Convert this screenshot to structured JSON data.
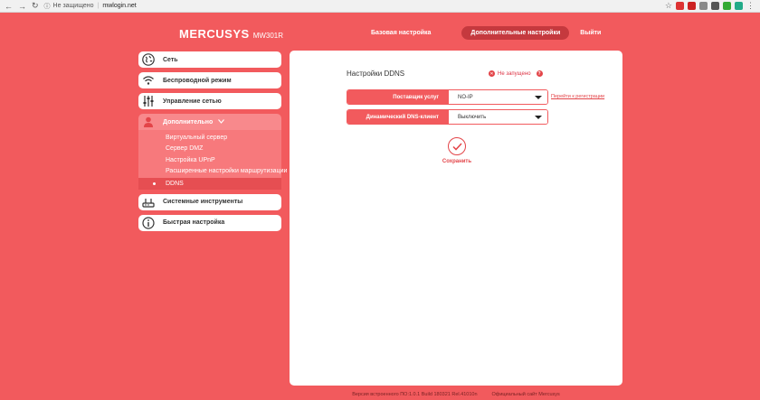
{
  "browser": {
    "security": "Не защищено",
    "url": "mwlogin.net"
  },
  "header": {
    "logo": "MERCUSYS",
    "model": "MW301R",
    "nav": [
      {
        "label": "Базовая настройка"
      },
      {
        "label": "Дополнительные настройки"
      },
      {
        "label": "Выйти"
      }
    ]
  },
  "sidebar": {
    "items": [
      {
        "label": "Сеть",
        "icon": "globe-icon"
      },
      {
        "label": "Беспроводной режим",
        "icon": "wifi-icon"
      },
      {
        "label": "Управление сетью",
        "icon": "sliders-icon"
      },
      {
        "label": "Дополнительно",
        "icon": "user-icon"
      },
      {
        "label": "Системные инструменты",
        "icon": "router-icon"
      },
      {
        "label": "Быстрая настройка",
        "icon": "info-icon"
      }
    ],
    "submenu": [
      "Виртуальный сервер",
      "Сервер DMZ",
      "Настройка UPnP",
      "Расширенные настройки маршрутизации",
      "DDNS"
    ]
  },
  "main": {
    "title": "Настройки DDNS",
    "status": "Не запущено",
    "provider_label": "Поставщик услуг",
    "provider_value": "NO-IP",
    "register_link": "Перейти к регистрации",
    "client_label": "Динамический DNS-клиент",
    "client_value": "Выключить",
    "save_label": "Сохранить"
  },
  "footer": {
    "firmware": "Версия встроенного ПО:1.0.1 Build 180321 Rel.41010n",
    "site": "Официальный сайт Mercusys"
  },
  "colors": {
    "background": "#f25a5d",
    "active_nav": "#c5393e",
    "accent": "#e34448"
  }
}
